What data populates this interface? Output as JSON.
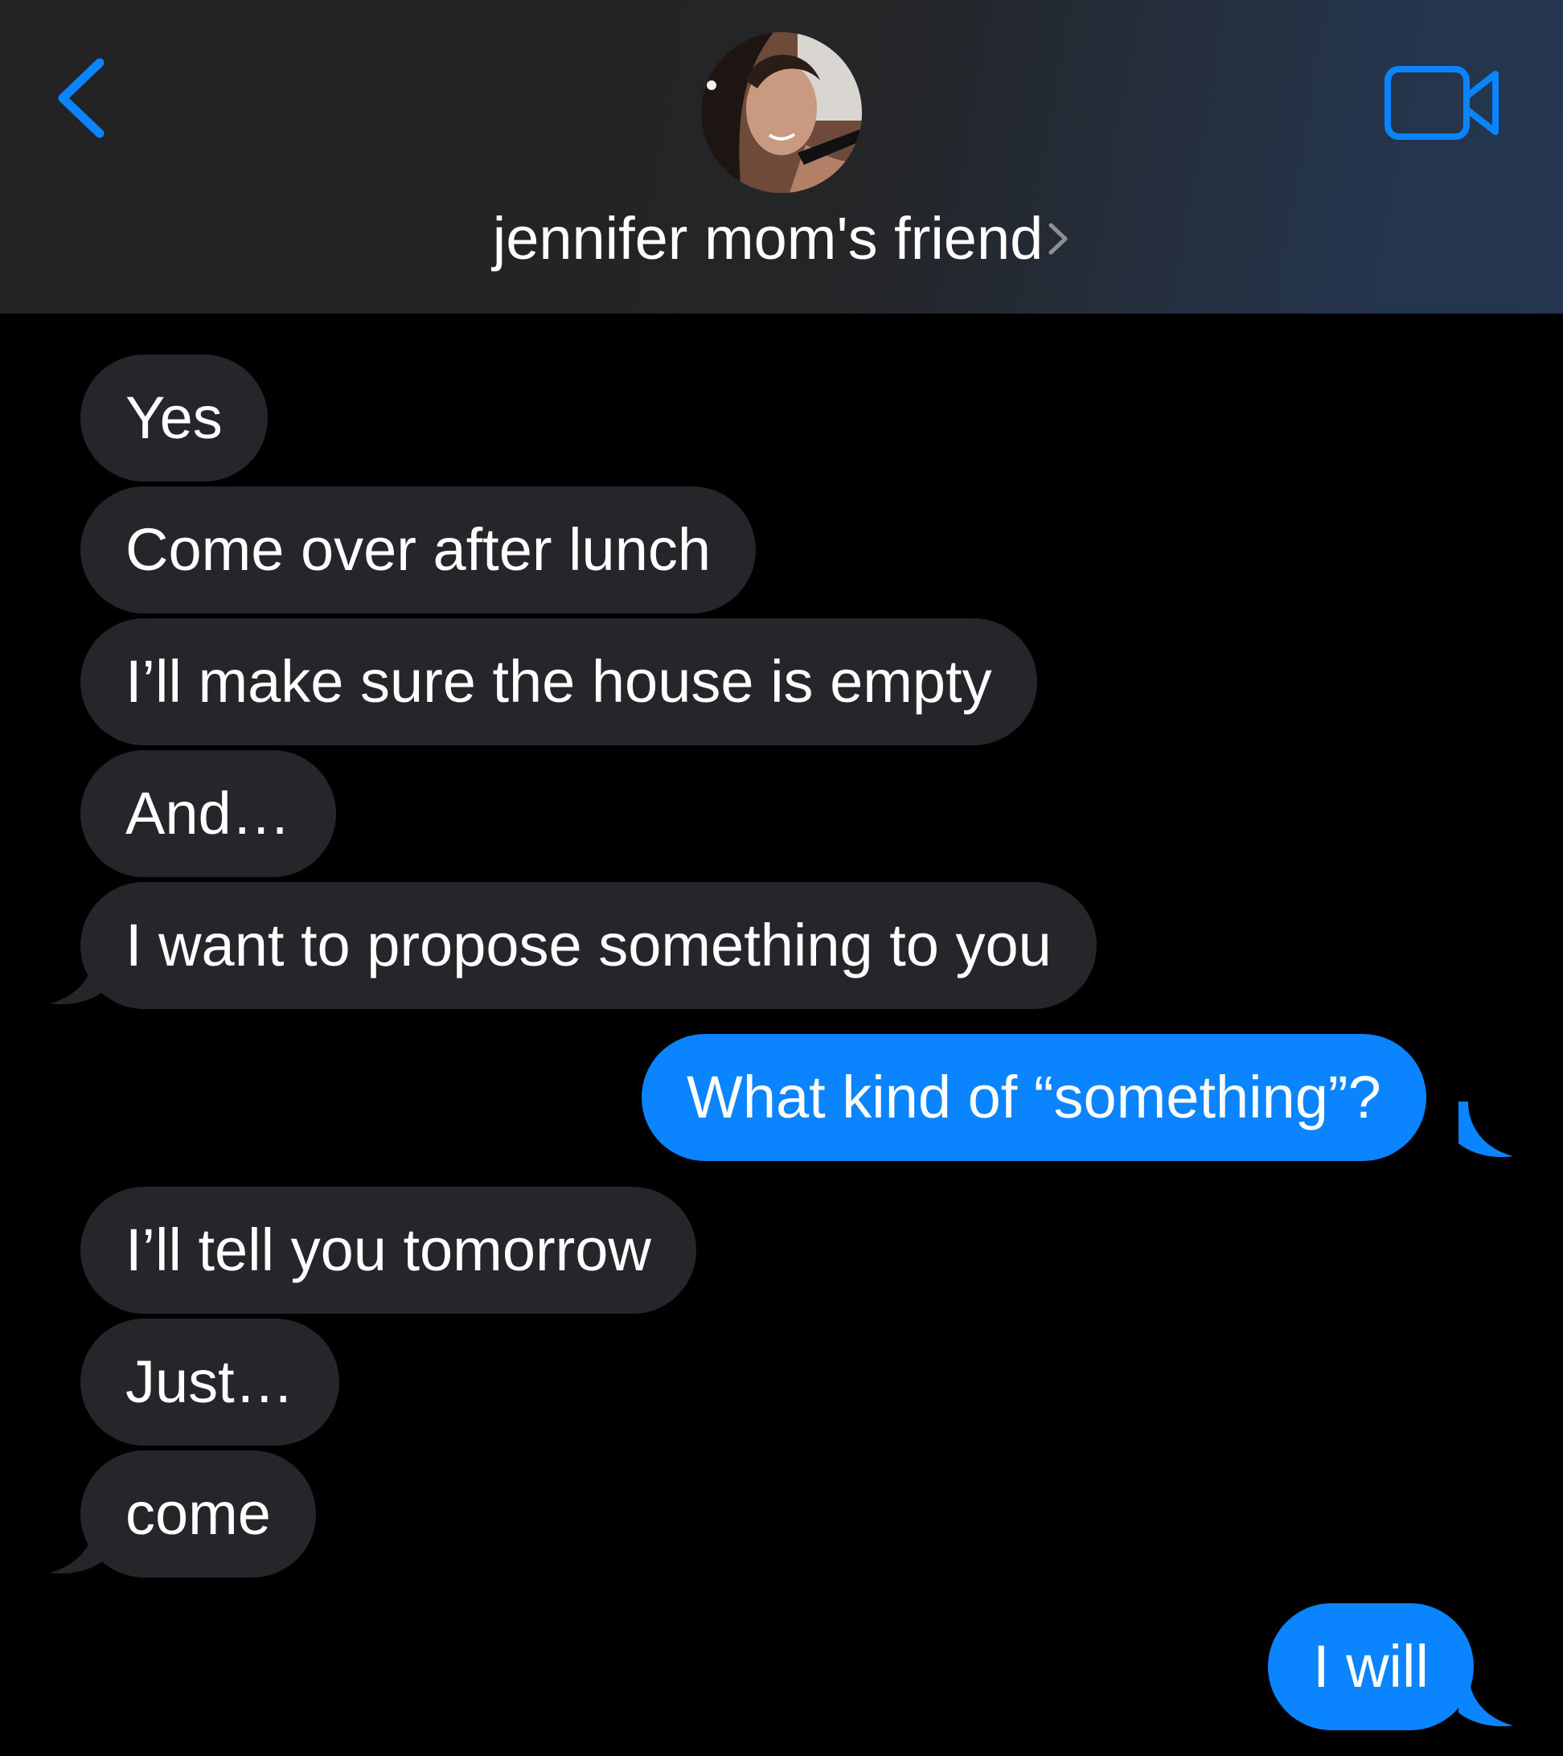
{
  "header": {
    "contact_name": "jennifer mom's friend",
    "back_icon": "chevron-left-icon",
    "video_icon": "video-camera-icon",
    "accent_color": "#0a84ff"
  },
  "messages": [
    {
      "direction": "incoming",
      "text": "Yes"
    },
    {
      "direction": "incoming",
      "text": "Come over after lunch"
    },
    {
      "direction": "incoming",
      "text": "I’ll make sure the house is empty"
    },
    {
      "direction": "incoming",
      "text": "And…"
    },
    {
      "direction": "incoming",
      "text": "I want to propose something to you"
    },
    {
      "direction": "outgoing",
      "text": "What kind of “something”?"
    },
    {
      "direction": "incoming",
      "text": "I’ll tell you tomorrow"
    },
    {
      "direction": "incoming",
      "text": "Just…"
    },
    {
      "direction": "incoming",
      "text": "come"
    },
    {
      "direction": "outgoing",
      "text": "I will"
    }
  ],
  "colors": {
    "incoming_bubble": "#26252a",
    "outgoing_bubble": "#0a84ff",
    "background": "#000000"
  }
}
